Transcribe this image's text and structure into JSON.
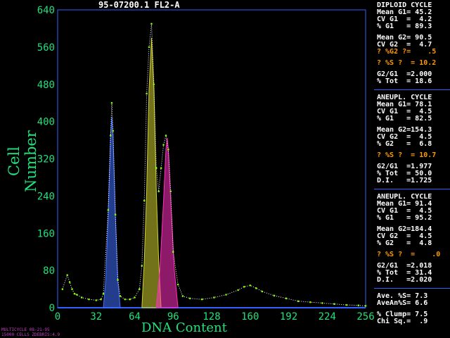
{
  "title": "95-07200.1 FL2-A",
  "footer": {
    "line1": "MULTICYCLE 08-21-95",
    "line2": "15000 CELLS ZDEBRIS:4.9"
  },
  "colors": {
    "axis": "#22e07a",
    "frame": "#3060ff",
    "diploid": "#4070ff",
    "aneu1": "#d0d030",
    "aneu2": "#ff30c0",
    "fit": "#ffffff"
  },
  "stats": {
    "diploid": {
      "header": "DIPLOID CYCLE",
      "rows": [
        "Mean G1= 45.2",
        "CV G1  =  4.2",
        "% G1   = 89.3",
        "",
        "Mean G2= 90.5",
        "CV G2  =  4.7"
      ],
      "warn": [
        "? %G2 ?=    .5",
        "",
        "? %S ?  = 10.2"
      ],
      "tail": [
        "",
        "G2/G1  =2.000",
        "% Tot  = 18.6"
      ]
    },
    "aneu1": {
      "header": "ANEUPL. CYCLE",
      "rows": [
        "Mean G1= 78.1",
        "CV G1  =  4.5",
        "% G1   = 82.5",
        "",
        "Mean G2=154.3",
        "CV G2  =  4.5",
        "% G2   =  6.8"
      ],
      "warn": [
        "",
        "? %S ?  = 10.7"
      ],
      "tail": [
        "",
        "G2/G1  =1.977",
        "% Tot  = 50.0",
        "D.I.   =1.725"
      ]
    },
    "aneu2": {
      "header": "ANEUPL. CYCLE",
      "rows": [
        "Mean G1= 91.4",
        "CV G1  =  4.5",
        "% G1   = 95.2",
        "",
        "Mean G2=184.4",
        "CV G2  =  4.5",
        "% G2   =  4.8"
      ],
      "warn": [
        "",
        "? %S ?  =    .0"
      ],
      "tail": [
        "",
        "G2/G1  =2.018",
        "% Tot  = 31.4",
        "D.I.   =2.020"
      ]
    },
    "summary": [
      "Ave. %S= 7.3",
      "AveAn%S= 6.6",
      "",
      "% Clump= 7.5",
      "Chi Sq.=  .9"
    ]
  },
  "chart_data": {
    "type": "area",
    "xlabel": "DNA Content",
    "ylabel": "Cell Number",
    "xlim": [
      0,
      256
    ],
    "ylim": [
      0,
      640
    ],
    "xticks": [
      0,
      32,
      64,
      96,
      128,
      160,
      192,
      224,
      256
    ],
    "yticks": [
      0,
      80,
      160,
      240,
      320,
      400,
      480,
      560,
      640
    ],
    "series": [
      {
        "name": "Diploid G1",
        "x": [
          38,
          40,
          42,
          44,
          45,
          46,
          48,
          50,
          52
        ],
        "y": [
          0,
          60,
          200,
          370,
          410,
          370,
          200,
          60,
          0
        ]
      },
      {
        "name": "Aneuploid G1 (78.1)",
        "x": [
          70,
          72,
          74,
          76,
          78,
          80,
          82,
          84,
          86
        ],
        "y": [
          0,
          100,
          250,
          470,
          580,
          470,
          250,
          100,
          0
        ]
      },
      {
        "name": "Aneuploid G1 (91.4)",
        "x": [
          82,
          85,
          88,
          90,
          91,
          92,
          94,
          97,
          100
        ],
        "y": [
          0,
          80,
          230,
          340,
          365,
          340,
          230,
          80,
          0
        ]
      },
      {
        "name": "Histogram",
        "x": [
          4,
          8,
          10,
          12,
          14,
          16,
          20,
          26,
          32,
          36,
          38,
          42,
          44,
          45,
          46,
          48,
          50,
          52,
          56,
          60,
          64,
          68,
          70,
          72,
          74,
          76,
          78,
          80,
          82,
          84,
          86,
          88,
          90,
          92,
          94,
          96,
          100,
          104,
          110,
          120,
          130,
          140,
          150,
          155,
          160,
          165,
          170,
          180,
          190,
          200,
          210,
          220,
          230,
          240,
          250,
          256
        ],
        "y": [
          40,
          70,
          55,
          40,
          30,
          28,
          22,
          18,
          16,
          18,
          30,
          210,
          370,
          440,
          380,
          200,
          60,
          25,
          18,
          18,
          22,
          40,
          90,
          230,
          460,
          560,
          610,
          480,
          300,
          250,
          300,
          350,
          370,
          340,
          250,
          120,
          50,
          25,
          20,
          18,
          22,
          28,
          38,
          45,
          48,
          42,
          35,
          26,
          20,
          14,
          12,
          10,
          8,
          6,
          5,
          4
        ]
      }
    ]
  }
}
